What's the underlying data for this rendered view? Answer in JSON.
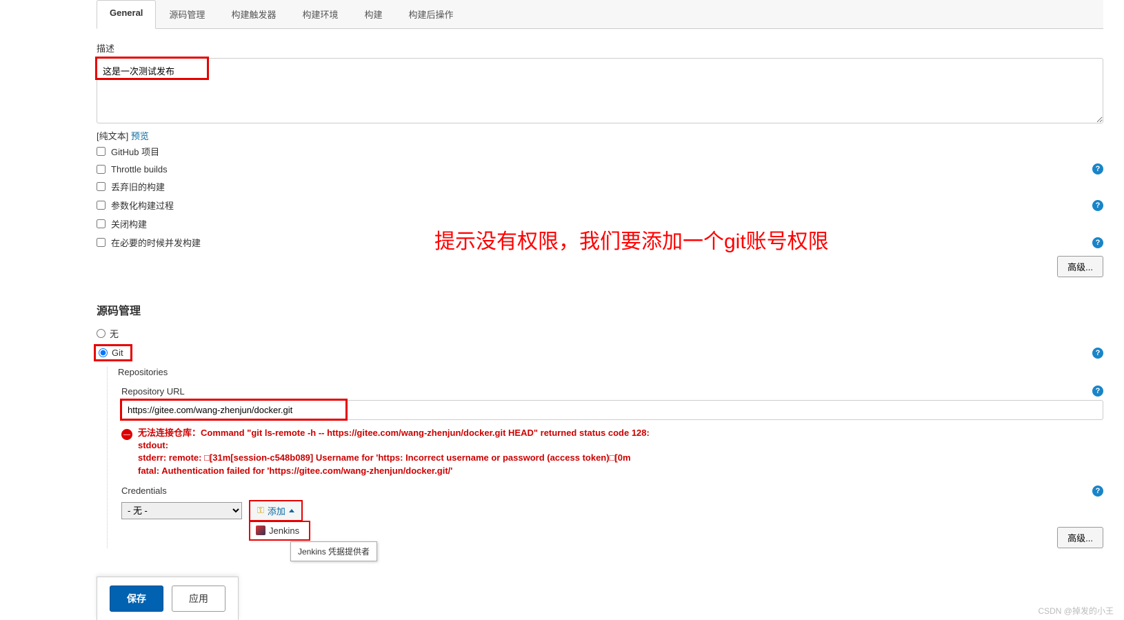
{
  "tabs": {
    "general": "General",
    "scm": "源码管理",
    "triggers": "构建触发器",
    "env": "构建环境",
    "build": "构建",
    "post": "构建后操作"
  },
  "desc": {
    "label": "描述",
    "value": "这是一次测试发布",
    "plaintext": "[纯文本]",
    "preview": "预览"
  },
  "checks": {
    "github": "GitHub 项目",
    "throttle": "Throttle builds",
    "discard": "丢弃旧的构建",
    "param": "参数化构建过程",
    "close": "关闭构建",
    "concurrent": "在必要的时候并发构建"
  },
  "advanced": "高级...",
  "annotation": "提示没有权限，我们要添加一个git账号权限",
  "scm": {
    "title": "源码管理",
    "none": "无",
    "git": "Git",
    "repositories": "Repositories",
    "repo_url_label": "Repository URL",
    "repo_url": "https://gitee.com/wang-zhenjun/docker.git",
    "error_l1": "无法连接仓库：Command \"git ls-remote -h -- https://gitee.com/wang-zhenjun/docker.git HEAD\" returned status code 128:",
    "error_l2": "stdout:",
    "error_l3": "stderr: remote: □[31m[session-c548b089] Username for 'https: Incorrect username or password (access token)□[0m",
    "error_l4": "fatal: Authentication failed for 'https://gitee.com/wang-zhenjun/docker.git/'",
    "credentials_label": "Credentials",
    "cred_option": "- 无 -",
    "add_btn": "添加",
    "dropdown_item": "Jenkins",
    "tooltip": "Jenkins 凭据提供者"
  },
  "buttons": {
    "save": "保存",
    "apply": "应用"
  },
  "watermark": "CSDN @掉发的小王",
  "help": "?"
}
